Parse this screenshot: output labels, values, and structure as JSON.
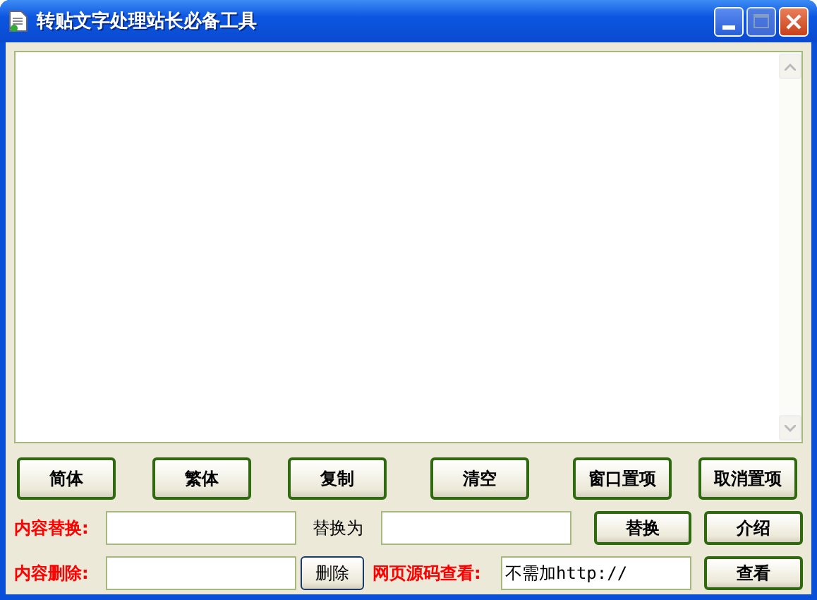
{
  "window": {
    "title": "转贴文字处理站长必备工具"
  },
  "toolbar_buttons": [
    "简体",
    "繁体",
    "复制",
    "清空",
    "窗口置项",
    "取消置项"
  ],
  "replace_row": {
    "label": "内容替换:",
    "with_label": "替换为",
    "replace_button": "替换",
    "about_button": "介绍"
  },
  "delete_row": {
    "label": "内容删除:",
    "delete_button": "删除",
    "source_label": "网页源码查看:",
    "source_value": "不需加http://",
    "view_button": "查看"
  }
}
